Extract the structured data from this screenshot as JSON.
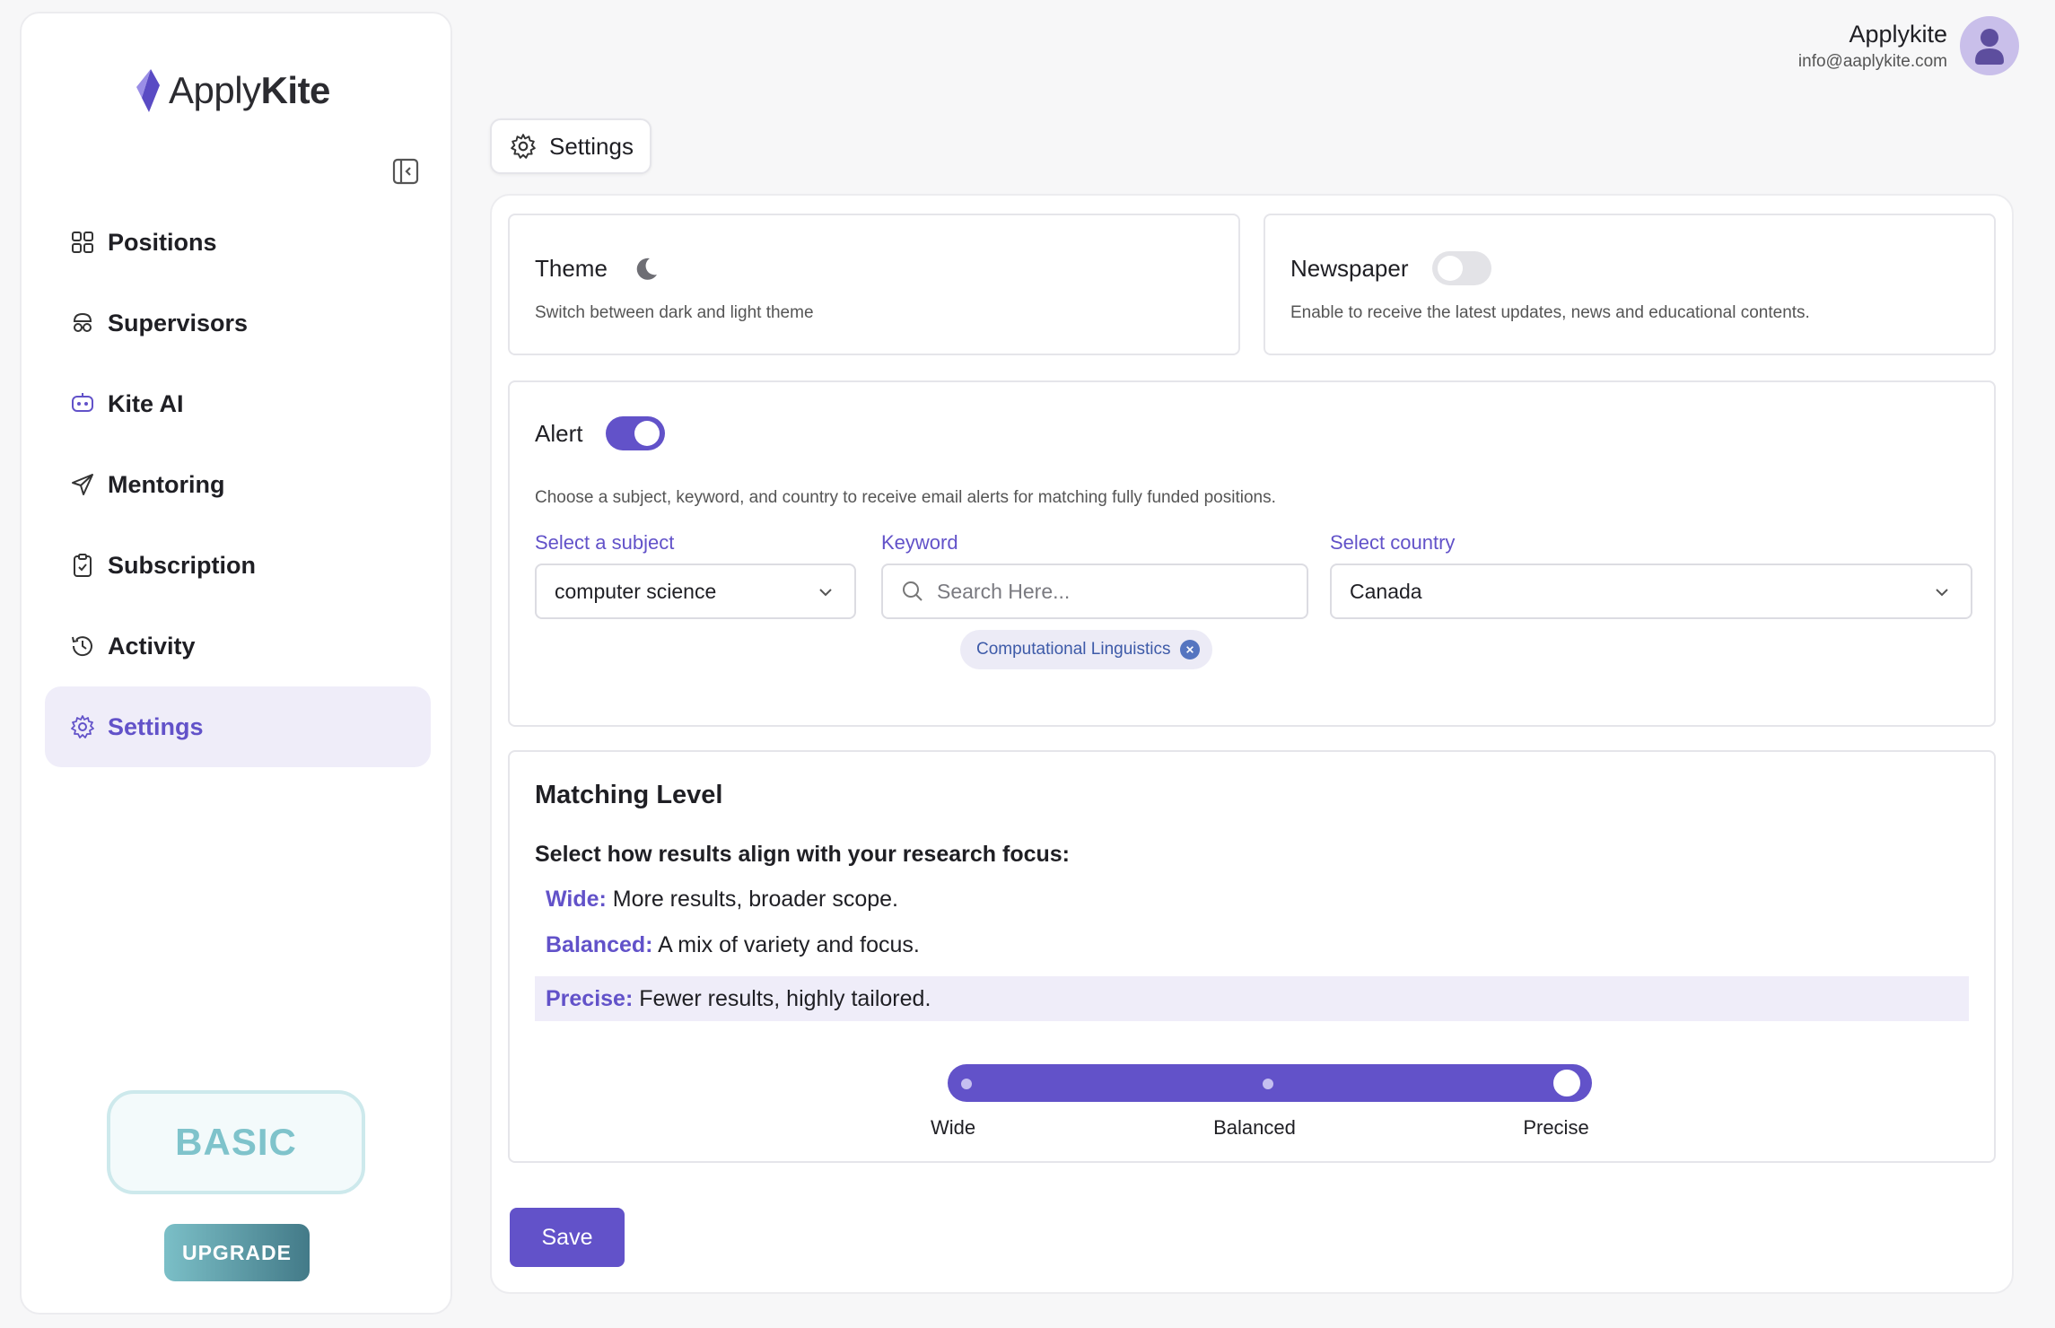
{
  "brand": {
    "name_light": "Apply",
    "name_bold": "Kite"
  },
  "sidebar": {
    "items": [
      {
        "label": "Positions",
        "icon": "grid-icon"
      },
      {
        "label": "Supervisors",
        "icon": "supervisor-icon"
      },
      {
        "label": "Kite AI",
        "icon": "robot-icon"
      },
      {
        "label": "Mentoring",
        "icon": "send-icon"
      },
      {
        "label": "Subscription",
        "icon": "clipboard-check-icon"
      },
      {
        "label": "Activity",
        "icon": "history-icon"
      },
      {
        "label": "Settings",
        "icon": "gear-icon",
        "active": true
      }
    ],
    "plan": "BASIC",
    "upgrade_label": "UPGRADE"
  },
  "header": {
    "user_name": "Applykite",
    "user_email": "info@aaplykite.com",
    "tab_label": "Settings"
  },
  "theme_card": {
    "title": "Theme",
    "subtitle": "Switch between dark and light theme",
    "icon": "moon-icon"
  },
  "newspaper_card": {
    "title": "Newspaper",
    "subtitle": "Enable to receive the latest updates, news and educational contents.",
    "enabled": false
  },
  "alert_card": {
    "title": "Alert",
    "enabled": true,
    "description": "Choose a subject, keyword, and country to receive email alerts for matching fully funded positions.",
    "subject_label": "Select a subject",
    "subject_value": "computer science",
    "keyword_label": "Keyword",
    "keyword_placeholder": "Search Here...",
    "keyword_chip": "Computational Linguistics",
    "country_label": "Select country",
    "country_value": "Canada"
  },
  "matching": {
    "title": "Matching Level",
    "prompt": "Select how results align with your research focus:",
    "levels": [
      {
        "key": "Wide:",
        "desc": "More results, broader scope."
      },
      {
        "key": "Balanced:",
        "desc": "A mix of variety and focus."
      },
      {
        "key": "Precise:",
        "desc": "Fewer results, highly tailored."
      }
    ],
    "slider_labels": [
      "Wide",
      "Balanced",
      "Precise"
    ],
    "selected": "Precise"
  },
  "save_label": "Save",
  "colors": {
    "accent": "#6252c9",
    "plan": "#7fc3cb"
  }
}
